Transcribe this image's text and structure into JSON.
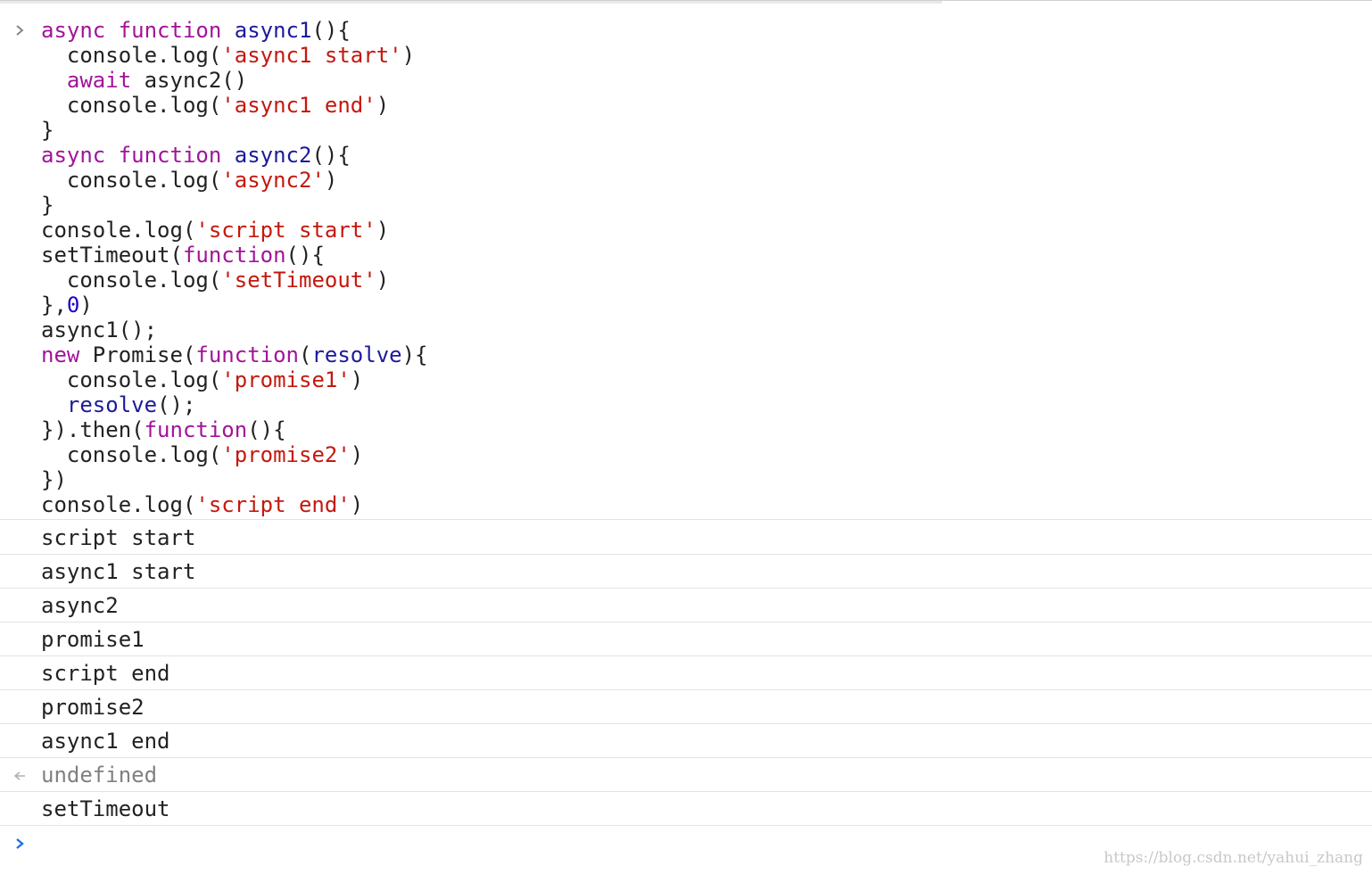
{
  "input": {
    "lines": [
      [
        {
          "c": "kw",
          "t": "async"
        },
        {
          "c": "plain",
          "t": " "
        },
        {
          "c": "kw",
          "t": "function"
        },
        {
          "c": "plain",
          "t": " "
        },
        {
          "c": "def",
          "t": "async1"
        },
        {
          "c": "plain",
          "t": "(){"
        }
      ],
      [
        {
          "c": "plain",
          "t": "  console.log("
        },
        {
          "c": "str",
          "t": "'async1 start'"
        },
        {
          "c": "plain",
          "t": ")"
        }
      ],
      [
        {
          "c": "plain",
          "t": "  "
        },
        {
          "c": "kw",
          "t": "await"
        },
        {
          "c": "plain",
          "t": " async2()"
        }
      ],
      [
        {
          "c": "plain",
          "t": "  console.log("
        },
        {
          "c": "str",
          "t": "'async1 end'"
        },
        {
          "c": "plain",
          "t": ")"
        }
      ],
      [
        {
          "c": "plain",
          "t": "}"
        }
      ],
      [
        {
          "c": "kw",
          "t": "async"
        },
        {
          "c": "plain",
          "t": " "
        },
        {
          "c": "kw",
          "t": "function"
        },
        {
          "c": "plain",
          "t": " "
        },
        {
          "c": "def",
          "t": "async2"
        },
        {
          "c": "plain",
          "t": "(){"
        }
      ],
      [
        {
          "c": "plain",
          "t": "  console.log("
        },
        {
          "c": "str",
          "t": "'async2'"
        },
        {
          "c": "plain",
          "t": ")"
        }
      ],
      [
        {
          "c": "plain",
          "t": "}"
        }
      ],
      [
        {
          "c": "plain",
          "t": "console.log("
        },
        {
          "c": "str",
          "t": "'script start'"
        },
        {
          "c": "plain",
          "t": ")"
        }
      ],
      [
        {
          "c": "plain",
          "t": "setTimeout("
        },
        {
          "c": "kw",
          "t": "function"
        },
        {
          "c": "plain",
          "t": "(){"
        }
      ],
      [
        {
          "c": "plain",
          "t": "  console.log("
        },
        {
          "c": "str",
          "t": "'setTimeout'"
        },
        {
          "c": "plain",
          "t": ")"
        }
      ],
      [
        {
          "c": "plain",
          "t": "},"
        },
        {
          "c": "num",
          "t": "0"
        },
        {
          "c": "plain",
          "t": ")"
        }
      ],
      [
        {
          "c": "plain",
          "t": "async1();"
        }
      ],
      [
        {
          "c": "kw",
          "t": "new"
        },
        {
          "c": "plain",
          "t": " Promise("
        },
        {
          "c": "kw",
          "t": "function"
        },
        {
          "c": "plain",
          "t": "("
        },
        {
          "c": "def",
          "t": "resolve"
        },
        {
          "c": "plain",
          "t": "){"
        }
      ],
      [
        {
          "c": "plain",
          "t": "  console.log("
        },
        {
          "c": "str",
          "t": "'promise1'"
        },
        {
          "c": "plain",
          "t": ")"
        }
      ],
      [
        {
          "c": "plain",
          "t": "  "
        },
        {
          "c": "def",
          "t": "resolve"
        },
        {
          "c": "plain",
          "t": "();"
        }
      ],
      [
        {
          "c": "plain",
          "t": "}).then("
        },
        {
          "c": "kw",
          "t": "function"
        },
        {
          "c": "plain",
          "t": "(){"
        }
      ],
      [
        {
          "c": "plain",
          "t": "  console.log("
        },
        {
          "c": "str",
          "t": "'promise2'"
        },
        {
          "c": "plain",
          "t": ")"
        }
      ],
      [
        {
          "c": "plain",
          "t": "})"
        }
      ],
      [
        {
          "c": "plain",
          "t": "console.log("
        },
        {
          "c": "str",
          "t": "'script end'"
        },
        {
          "c": "plain",
          "t": ")"
        }
      ]
    ]
  },
  "logs": [
    {
      "text": "script start",
      "kind": "log"
    },
    {
      "text": "async1 start",
      "kind": "log"
    },
    {
      "text": "async2",
      "kind": "log"
    },
    {
      "text": "promise1",
      "kind": "log"
    },
    {
      "text": "script end",
      "kind": "log"
    },
    {
      "text": "promise2",
      "kind": "log"
    },
    {
      "text": "async1 end",
      "kind": "log"
    },
    {
      "text": "undefined",
      "kind": "result"
    },
    {
      "text": "setTimeout",
      "kind": "log"
    }
  ],
  "watermark": "https://blog.csdn.net/yahui_zhang",
  "colors": {
    "keyword": "#a1149a",
    "definition": "#1c1a9a",
    "string": "#c4180e",
    "number": "#1c00cf",
    "prompt": "#1a73e8",
    "input_chevron": "#808080",
    "result_arrow": "#b0b0b0"
  },
  "icons": {
    "input_prompt": "chevron-right-icon",
    "result_marker": "return-arrow-icon",
    "active_prompt": "chevron-right-icon"
  }
}
